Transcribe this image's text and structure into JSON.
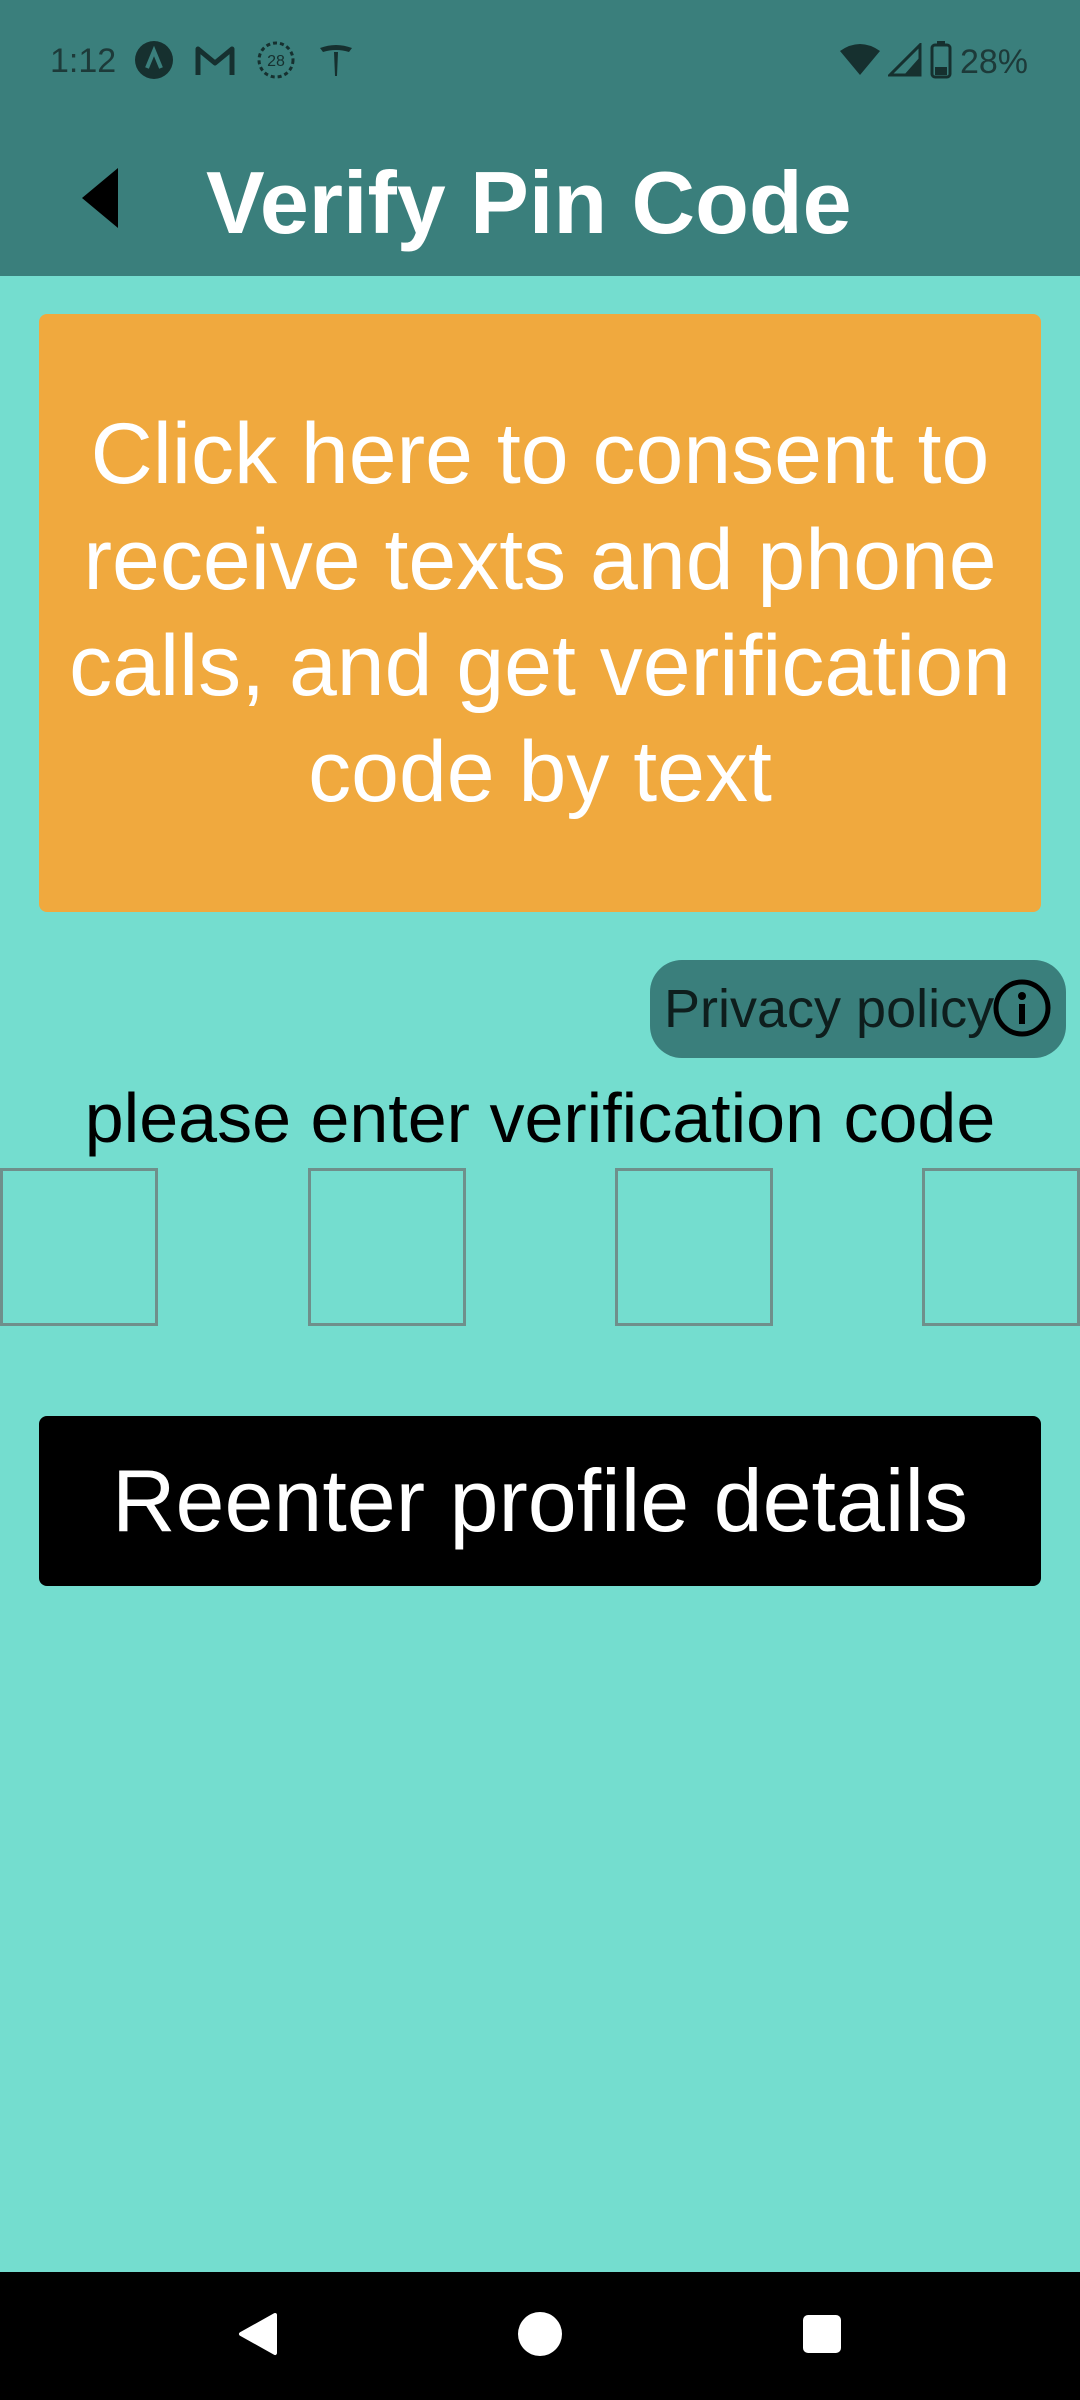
{
  "status_bar": {
    "time": "1:12",
    "notification_icons": [
      "a-icon",
      "gmail-icon",
      "calendar-28-icon",
      "tesla-icon"
    ],
    "calendar_badge": "28",
    "battery_percent": "28%"
  },
  "app_bar": {
    "title": "Verify Pin Code"
  },
  "consent": {
    "label": "Click here to consent to receive texts and phone calls, and get verification code by text"
  },
  "privacy": {
    "label": "Privacy policy"
  },
  "verification": {
    "prompt": "please enter verification code",
    "boxes": [
      "",
      "",
      "",
      ""
    ]
  },
  "reenter": {
    "label": "Reenter profile details"
  },
  "colors": {
    "background": "#74DDCF",
    "app_bar": "#3A7F7C",
    "consent_button": "#F0A93E",
    "reenter_button": "#000000"
  }
}
